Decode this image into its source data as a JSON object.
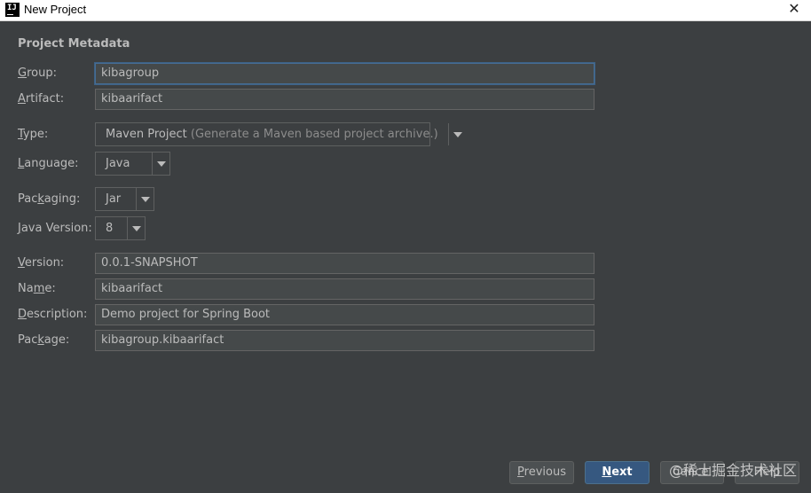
{
  "window": {
    "title": "New Project",
    "app_icon": "intellij-icon",
    "close_glyph": "✕"
  },
  "section_title": "Project Metadata",
  "fields": {
    "group": {
      "label_mn": "G",
      "label_rest": "roup:",
      "value": "kibagroup"
    },
    "artifact": {
      "label_mn": "A",
      "label_rest": "rtifact:",
      "value": "kibaarifact"
    },
    "version": {
      "label_mn": "V",
      "label_rest": "ersion:",
      "value": "0.0.1-SNAPSHOT"
    },
    "name": {
      "label_pre": "Na",
      "label_mn": "m",
      "label_rest": "e:",
      "value": "kibaarifact"
    },
    "description": {
      "label_mn": "D",
      "label_rest": "escription:",
      "value": "Demo project for Spring Boot"
    },
    "package": {
      "label_pre": "Pac",
      "label_mn": "k",
      "label_rest": "age:",
      "value": "kibagroup.kibaarifact"
    }
  },
  "combos": {
    "type": {
      "label_mn": "T",
      "label_rest": "ype:",
      "value": "Maven Project",
      "hint": "(Generate a Maven based project archive.)"
    },
    "language": {
      "label_mn": "L",
      "label_rest": "anguage:",
      "value": "Java"
    },
    "packaging": {
      "label_pre": "Pac",
      "label_mn": "k",
      "label_rest": "aging:",
      "value": "Jar"
    },
    "java_version": {
      "label_mn": "J",
      "label_rest": "ava Version:",
      "value": "8"
    }
  },
  "buttons": {
    "previous": {
      "label_mn": "P",
      "label_rest": "revious"
    },
    "next": {
      "label_mn": "N",
      "label_rest": "ext"
    },
    "cancel": {
      "label": "Cancel"
    },
    "help": {
      "label": "Help"
    }
  },
  "watermark": "@稀土掘金技术社区",
  "colors": {
    "background": "#3c3f41",
    "field_bg": "#45494a",
    "focus_border": "#466d94",
    "primary_button": "#365880"
  }
}
